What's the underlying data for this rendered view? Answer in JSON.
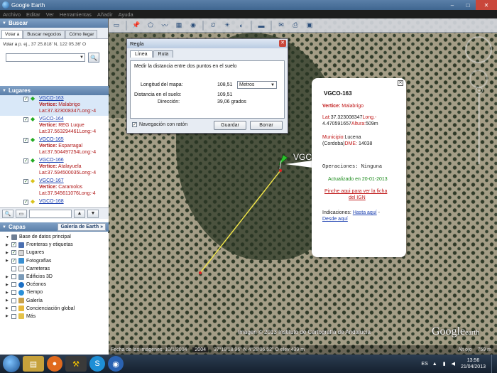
{
  "window": {
    "title": "Google Earth",
    "controls": [
      "–",
      "□",
      "✕"
    ]
  },
  "menu": [
    "Archivo",
    "Editar",
    "Ver",
    "Herramientas",
    "Añadir",
    "Ayuda"
  ],
  "search": {
    "header": "Buscar",
    "tabs": [
      "Volar a",
      "Buscar negocios",
      "Cómo llegar"
    ],
    "hint_prefix": "Volar a",
    "hint": " p. ej., 37 25.818' N, 122 05.36' O",
    "input_value": ""
  },
  "places": {
    "header": "Lugares",
    "items": [
      {
        "name": "VGCO-163",
        "vertex_label": "Vertice:",
        "vertex": "Malabrigo",
        "lat": "Lat:37.323008347Long:-4",
        "pin": "green",
        "selected": true
      },
      {
        "name": "VGCO-164",
        "vertex_label": "Vertice:",
        "vertex": "REG Luque",
        "lat": "Lat:37.563294461Long:-4",
        "pin": "green",
        "selected": false
      },
      {
        "name": "VGCO-165",
        "vertex_label": "Vertice:",
        "vertex": "Esparragal",
        "lat": "Lat:37.504497254Long:-4",
        "pin": "green",
        "selected": false
      },
      {
        "name": "VGCO-166",
        "vertex_label": "Vertice:",
        "vertex": "Atalayuela",
        "lat": "Lat:37.594500035Long:-4",
        "pin": "green",
        "selected": false
      },
      {
        "name": "VGCO-167",
        "vertex_label": "Vertice:",
        "vertex": "Caramolos",
        "lat": "Lat:37.545611076Long:-4",
        "pin": "yellow",
        "selected": false
      },
      {
        "name": "VGCO-168",
        "vertex_label": "",
        "vertex": "",
        "lat": "",
        "pin": "yellow",
        "selected": false
      }
    ]
  },
  "layers": {
    "header": "Capas",
    "gallery_button": "Galería de Earth »",
    "items": [
      {
        "name": "Base de datos principal",
        "icon_color": "#6f7f94",
        "checked": false,
        "expand": "▼",
        "has_check": false
      },
      {
        "name": "Fronteras y etiquetas",
        "icon_color": "#4a6fb0",
        "checked": true,
        "expand": "▶",
        "has_check": true
      },
      {
        "name": "Lugares",
        "icon_color": "#d6d6d6",
        "checked": true,
        "expand": "▶",
        "has_check": true
      },
      {
        "name": "Fotografías",
        "icon_color": "#3a8fd0",
        "checked": true,
        "expand": "▶",
        "has_check": true
      },
      {
        "name": "Carreteras",
        "icon_color": "#f3f3f3",
        "checked": false,
        "expand": "",
        "has_check": true
      },
      {
        "name": "Edificios 3D",
        "icon_color": "#7a9ab8",
        "checked": false,
        "expand": "▶",
        "has_check": true
      },
      {
        "name": "Océanos",
        "icon_color": "#1d6fc4",
        "checked": false,
        "expand": "▶",
        "has_check": true
      },
      {
        "name": "Tiempo",
        "icon_color": "#2a90d8",
        "checked": false,
        "expand": "▶",
        "has_check": true
      },
      {
        "name": "Galería",
        "icon_color": "#caa24a",
        "checked": false,
        "expand": "▶",
        "has_check": true
      },
      {
        "name": "Concienciación global",
        "icon_color": "#e8b93a",
        "checked": false,
        "expand": "▶",
        "has_check": true
      },
      {
        "name": "Más",
        "icon_color": "#e4c24a",
        "checked": false,
        "expand": "▶",
        "has_check": true
      }
    ]
  },
  "ruler": {
    "title": "Regla",
    "tabs": [
      "Línea",
      "Ruta"
    ],
    "description": "Medir la distancia entre dos puntos en el suelo",
    "map_length_label": "Longitud del mapa:",
    "map_length_value": "108,51",
    "unit": "Metros",
    "ground_length_label": "Distancia en el suelo:",
    "ground_length_value": "109,51",
    "heading_label": "Dirección:",
    "heading_value": "39,06 grados",
    "mouse_nav_label": "Navegación con ratón",
    "mouse_nav_checked": true,
    "save_button": "Guardar",
    "clear_button": "Borrar"
  },
  "placemark_label": "VGCO",
  "balloon": {
    "title": "VGCO-163",
    "vertex_label": "Vertice:",
    "vertex": "Malabrigo",
    "lat_label": "Lat:",
    "lat": "37.323008347",
    "long_label": "Long.-",
    "long": "4.470591657",
    "alt_label": "Altura:",
    "alt": "509m",
    "municipio_label": "Municipio:",
    "municipio": "Lucena",
    "provincia": "(Cordoba)",
    "dme_label": "DME:",
    "dme": " 14038",
    "operaciones": "Operaciones: Ninguna",
    "actualizado": "Actualizado en 20-01-2013",
    "ficha_link_1": "Pinche aqui para ver la ficha",
    "ficha_link_2": "del IGN",
    "indicaciones_label": "Indicaciones:",
    "hasta_aqui": "Hasta aquí",
    "desde_aqui": "Desde aquí",
    "sep": " -"
  },
  "map": {
    "copyright": "Imagen © 2013 Instituto de Cartografía de Andalucía",
    "logo": "Google",
    "logo_suffix": "earth",
    "status_date": "Fecha de las imágenes: 10/1/2004",
    "status_year": "2004",
    "status_coords": "37°19'18.96\" N   4°28'06.52\" O  elev  439 m",
    "status_alt_label": "Alt ojo",
    "status_alt": "759 m"
  },
  "taskbar": {
    "language": "ES",
    "time": "13:56",
    "date": "21/04/2013"
  }
}
